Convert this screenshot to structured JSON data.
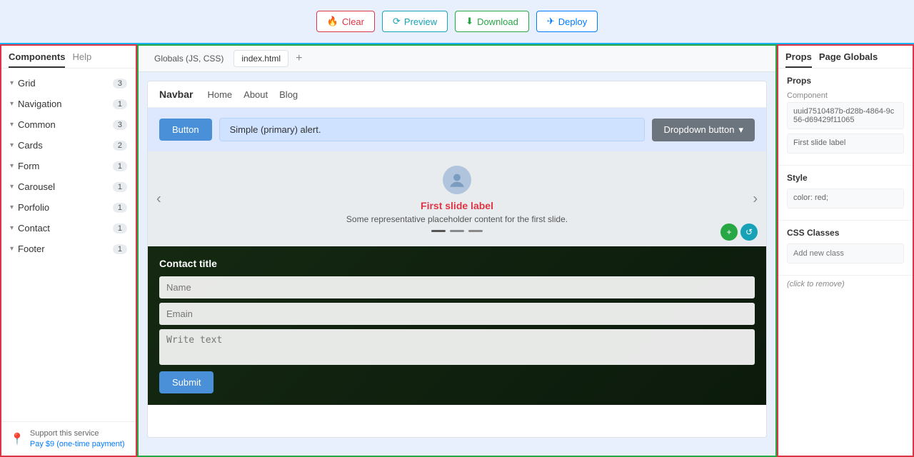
{
  "toolbar": {
    "clear_label": "Clear",
    "preview_label": "Preview",
    "download_label": "Download",
    "deploy_label": "Deploy"
  },
  "sidebar_left": {
    "tabs": [
      {
        "label": "Components",
        "active": true
      },
      {
        "label": "Help",
        "active": false
      }
    ],
    "items": [
      {
        "label": "Grid",
        "count": 3
      },
      {
        "label": "Navigation",
        "count": 1
      },
      {
        "label": "Common",
        "count": 3
      },
      {
        "label": "Cards",
        "count": 2
      },
      {
        "label": "Form",
        "count": 1
      },
      {
        "label": "Carousel",
        "count": 1
      },
      {
        "label": "Porfolio",
        "count": 1
      },
      {
        "label": "Contact",
        "count": 1
      },
      {
        "label": "Footer",
        "count": 1
      }
    ],
    "footer": {
      "support_label": "Support this service",
      "pay_label": "Pay $9 (one-time payment)"
    }
  },
  "canvas": {
    "tabs": [
      {
        "label": "Globals (JS, CSS)",
        "active": false
      },
      {
        "label": "index.html",
        "active": true
      }
    ],
    "preview": {
      "navbar": {
        "brand": "Navbar",
        "links": [
          "Home",
          "About",
          "Blog"
        ]
      },
      "button_label": "Button",
      "alert_text": "Simple (primary) alert.",
      "dropdown_label": "Dropdown button",
      "carousel": {
        "title": "First slide label",
        "description": "Some representative placeholder content for the first slide."
      },
      "contact": {
        "title": "Contact title",
        "name_placeholder": "Name",
        "email_placeholder": "Emain",
        "textarea_placeholder": "Write text",
        "submit_label": "Submit"
      }
    }
  },
  "sidebar_right": {
    "tabs": [
      {
        "label": "Props",
        "active": true
      },
      {
        "label": "Page Globals",
        "active": false
      }
    ],
    "props_title": "Props",
    "component_label": "Component",
    "component_value": "uuid7510487b-d28b-4864-9c56-d69429f11065",
    "first_slide_label": "First slide label",
    "style_title": "Style",
    "style_value": "color: red;",
    "css_classes_title": "CSS Classes",
    "css_classes_placeholder": "Add new class",
    "click_to_remove": "(click to remove)"
  }
}
